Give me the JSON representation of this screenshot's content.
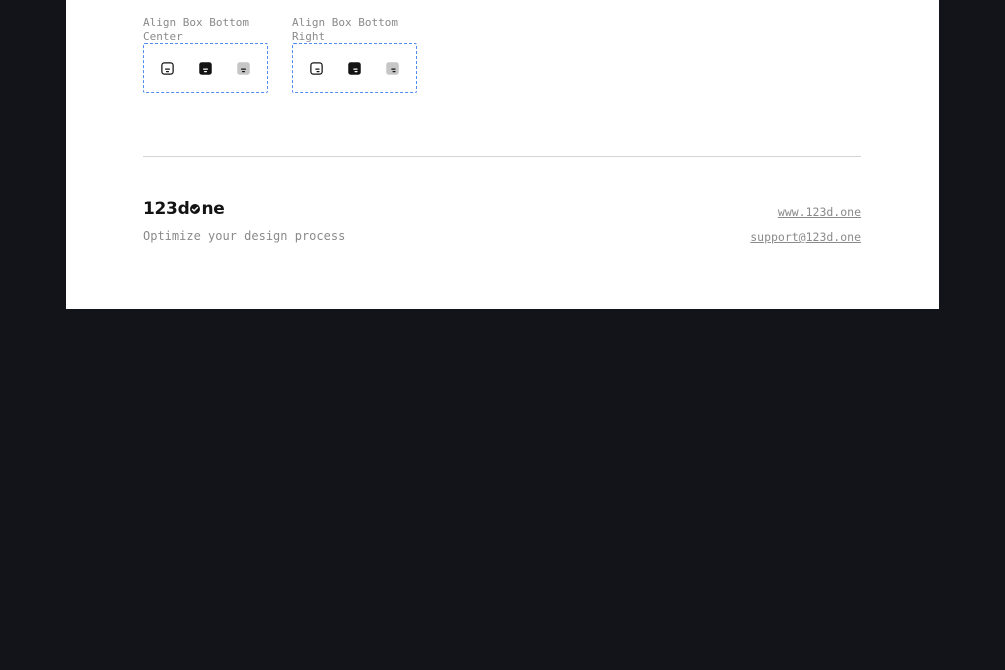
{
  "icon_groups": [
    {
      "label": "Align Box Bottom Center",
      "icons": [
        {
          "name": "align-box-bottom-center-outline-icon",
          "variant": "outline"
        },
        {
          "name": "align-box-bottom-center-filled-icon",
          "variant": "filled"
        },
        {
          "name": "align-box-bottom-center-duotone-icon",
          "variant": "duotone"
        }
      ]
    },
    {
      "label": "Align Box Bottom Right",
      "icons": [
        {
          "name": "align-box-bottom-right-outline-icon",
          "variant": "outline"
        },
        {
          "name": "align-box-bottom-right-filled-icon",
          "variant": "filled"
        },
        {
          "name": "align-box-bottom-right-duotone-icon",
          "variant": "duotone"
        }
      ]
    }
  ],
  "footer": {
    "logo": "123done",
    "logo_parts": {
      "before": "123d",
      "after": "ne"
    },
    "tagline": "Optimize your design process",
    "website": "www.123d.one",
    "email": "support@123d.one"
  },
  "colors": {
    "page_background": "#121419",
    "sheet_background": "#ffffff",
    "dashed_border": "#4f8cf0",
    "muted_text": "#8a8a8a",
    "icon_dark": "#131313",
    "icon_duotone": "#c6c6c6"
  }
}
